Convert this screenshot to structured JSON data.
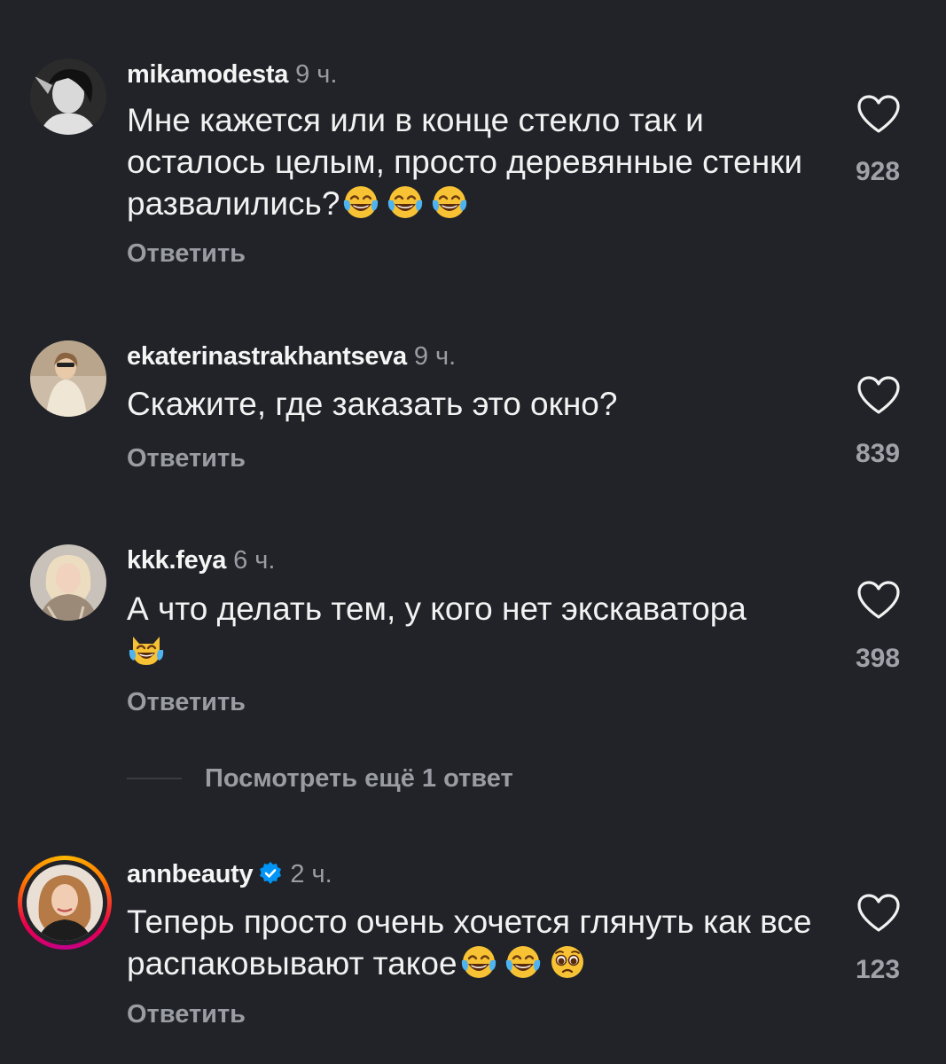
{
  "comments": [
    {
      "username": "mikamodesta",
      "time": "9 ч.",
      "text": "Мне кажется или в конце стекло так и осталось целым, просто деревянные стенки развалились?",
      "emojis": [
        "joy-emoji",
        "joy-emoji",
        "joy-emoji"
      ],
      "likes": "928",
      "reply_label": "Ответить"
    },
    {
      "username": "ekaterinastrakhantseva",
      "time": "9 ч.",
      "text": "Скажите, где заказать это окно?",
      "emojis": [],
      "likes": "839",
      "reply_label": "Ответить"
    },
    {
      "username": "kkk.feya",
      "time": "6 ч.",
      "text": "А что делать тем, у кого нет экскаватора",
      "emojis": [
        "cat-joy-emoji"
      ],
      "likes": "398",
      "reply_label": "Ответить",
      "view_more_replies": "Посмотреть ещё 1 ответ"
    },
    {
      "username": "annbeauty",
      "verified": true,
      "time": "2 ч.",
      "text": "Теперь просто очень хочется глянуть как все распаковывают такое",
      "emojis": [
        "joy-emoji",
        "joy-emoji",
        "pleading-face-emoji"
      ],
      "likes": "123",
      "reply_label": "Ответить"
    }
  ],
  "colors": {
    "background": "#212328",
    "text_primary": "#f5f5f5",
    "text_secondary": "#9a9ca3",
    "verified_blue": "#0095f6"
  }
}
